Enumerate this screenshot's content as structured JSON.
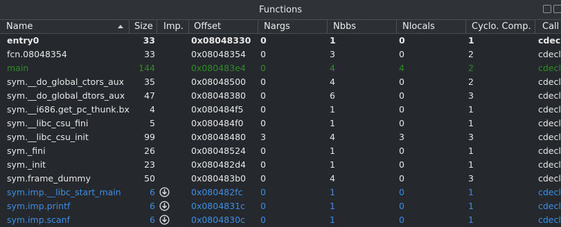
{
  "window": {
    "title": "Functions"
  },
  "columns": [
    "Name",
    "Size",
    "Imp.",
    "Offset",
    "Nargs",
    "Nbbs",
    "Nlocals",
    "Cyclo. Comp.",
    "Call"
  ],
  "rows": [
    {
      "name": "entry0",
      "size": "33",
      "imp": false,
      "offset": "0x08048330",
      "nargs": "0",
      "nbbs": "1",
      "nlocals": "0",
      "cyclo": "1",
      "call": "cdecl",
      "style": "bold"
    },
    {
      "name": "fcn.08048354",
      "size": "33",
      "imp": false,
      "offset": "0x08048354",
      "nargs": "0",
      "nbbs": "3",
      "nlocals": "0",
      "cyclo": "2",
      "call": "cdecl",
      "style": "normal"
    },
    {
      "name": "main",
      "size": "144",
      "imp": false,
      "offset": "0x080483e4",
      "nargs": "0",
      "nbbs": "4",
      "nlocals": "4",
      "cyclo": "2",
      "call": "cdecl",
      "style": "green"
    },
    {
      "name": "sym.__do_global_ctors_aux",
      "size": "35",
      "imp": false,
      "offset": "0x08048500",
      "nargs": "0",
      "nbbs": "4",
      "nlocals": "0",
      "cyclo": "2",
      "call": "cdecl",
      "style": "normal"
    },
    {
      "name": "sym.__do_global_dtors_aux",
      "size": "47",
      "imp": false,
      "offset": "0x08048380",
      "nargs": "0",
      "nbbs": "6",
      "nlocals": "0",
      "cyclo": "3",
      "call": "cdecl",
      "style": "normal"
    },
    {
      "name": "sym.__i686.get_pc_thunk.bx",
      "size": "4",
      "imp": false,
      "offset": "0x080484f5",
      "nargs": "0",
      "nbbs": "1",
      "nlocals": "0",
      "cyclo": "1",
      "call": "cdecl",
      "style": "normal"
    },
    {
      "name": "sym.__libc_csu_fini",
      "size": "5",
      "imp": false,
      "offset": "0x080484f0",
      "nargs": "0",
      "nbbs": "1",
      "nlocals": "0",
      "cyclo": "1",
      "call": "cdecl",
      "style": "normal"
    },
    {
      "name": "sym.__libc_csu_init",
      "size": "99",
      "imp": false,
      "offset": "0x08048480",
      "nargs": "3",
      "nbbs": "4",
      "nlocals": "3",
      "cyclo": "3",
      "call": "cdecl",
      "style": "normal"
    },
    {
      "name": "sym._fini",
      "size": "26",
      "imp": false,
      "offset": "0x08048524",
      "nargs": "0",
      "nbbs": "1",
      "nlocals": "0",
      "cyclo": "1",
      "call": "cdecl",
      "style": "normal"
    },
    {
      "name": "sym._init",
      "size": "23",
      "imp": false,
      "offset": "0x080482d4",
      "nargs": "0",
      "nbbs": "1",
      "nlocals": "0",
      "cyclo": "1",
      "call": "cdecl",
      "style": "normal"
    },
    {
      "name": "sym.frame_dummy",
      "size": "50",
      "imp": false,
      "offset": "0x080483b0",
      "nargs": "0",
      "nbbs": "4",
      "nlocals": "0",
      "cyclo": "3",
      "call": "cdecl",
      "style": "normal"
    },
    {
      "name": "sym.imp.__libc_start_main",
      "size": "6",
      "imp": true,
      "offset": "0x080482fc",
      "nargs": "0",
      "nbbs": "1",
      "nlocals": "0",
      "cyclo": "1",
      "call": "cdecl",
      "style": "import"
    },
    {
      "name": "sym.imp.printf",
      "size": "6",
      "imp": true,
      "offset": "0x0804831c",
      "nargs": "0",
      "nbbs": "1",
      "nlocals": "0",
      "cyclo": "1",
      "call": "cdecl",
      "style": "import"
    },
    {
      "name": "sym.imp.scanf",
      "size": "6",
      "imp": true,
      "offset": "0x0804830c",
      "nargs": "0",
      "nbbs": "1",
      "nlocals": "0",
      "cyclo": "1",
      "call": "cdecl",
      "style": "import"
    }
  ],
  "colors": {
    "normal": "#e8e8e8",
    "green": "#2e8b26",
    "import": "#3e8ee6",
    "background": "#25282c",
    "header": "#2c3034"
  },
  "icons": {
    "import": "download-arrow-icon"
  }
}
